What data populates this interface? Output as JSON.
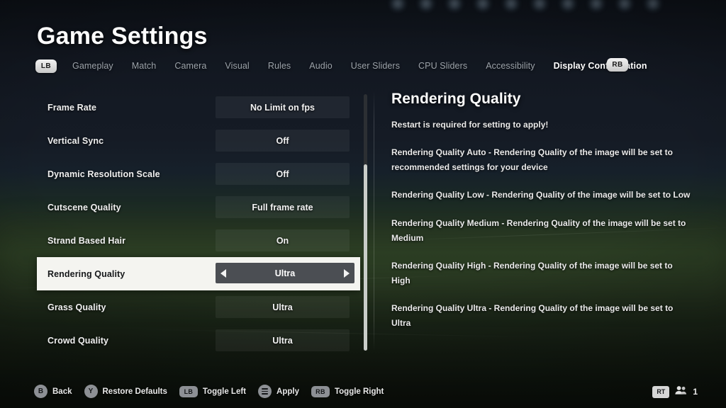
{
  "header": {
    "title": "Game Settings",
    "left_bumper": "LB",
    "right_bumper": "RB"
  },
  "tabs": [
    {
      "label": "Gameplay",
      "active": false
    },
    {
      "label": "Match",
      "active": false
    },
    {
      "label": "Camera",
      "active": false
    },
    {
      "label": "Visual",
      "active": false
    },
    {
      "label": "Rules",
      "active": false
    },
    {
      "label": "Audio",
      "active": false
    },
    {
      "label": "User Sliders",
      "active": false
    },
    {
      "label": "CPU Sliders",
      "active": false
    },
    {
      "label": "Accessibility",
      "active": false
    },
    {
      "label": "Display Configuration",
      "active": true
    }
  ],
  "settings": [
    {
      "label": "Frame Rate",
      "value": "No Limit on fps",
      "selected": false
    },
    {
      "label": "Vertical Sync",
      "value": "Off",
      "selected": false
    },
    {
      "label": "Dynamic Resolution Scale",
      "value": "Off",
      "selected": false
    },
    {
      "label": "Cutscene Quality",
      "value": "Full frame rate",
      "selected": false
    },
    {
      "label": "Strand Based Hair",
      "value": "On",
      "selected": false
    },
    {
      "label": "Rendering Quality",
      "value": "Ultra",
      "selected": true
    },
    {
      "label": "Grass Quality",
      "value": "Ultra",
      "selected": false
    },
    {
      "label": "Crowd Quality",
      "value": "Ultra",
      "selected": false
    }
  ],
  "detail": {
    "title": "Rendering Quality",
    "note": "Restart is required for setting to apply!",
    "descriptions": [
      "Rendering Quality Auto - Rendering Quality of the image will be set to recommended settings for your device",
      "Rendering Quality Low - Rendering Quality of the image will be set to Low",
      "Rendering Quality Medium - Rendering Quality of the image will be set to Medium",
      "Rendering Quality High - Rendering Quality of the image will be set to High",
      "Rendering Quality Ultra - Rendering Quality of the image will be set to Ultra"
    ]
  },
  "footer": {
    "actions": [
      {
        "button": "B",
        "label": "Back",
        "type": "circle"
      },
      {
        "button": "Y",
        "label": "Restore Defaults",
        "type": "circle"
      },
      {
        "button": "LB",
        "label": "Toggle Left",
        "type": "bumper"
      },
      {
        "button": "menu-icon",
        "label": "Apply",
        "type": "menu"
      },
      {
        "button": "RB",
        "label": "Toggle Right",
        "type": "bumper"
      }
    ],
    "trigger": "RT",
    "player_count": "1"
  },
  "colors": {
    "selected_row_bg": "#f4f4f0",
    "selector_pill": "#4b4e53",
    "accent_text": "#ffffff",
    "muted_tab": "#9ca3aa"
  }
}
